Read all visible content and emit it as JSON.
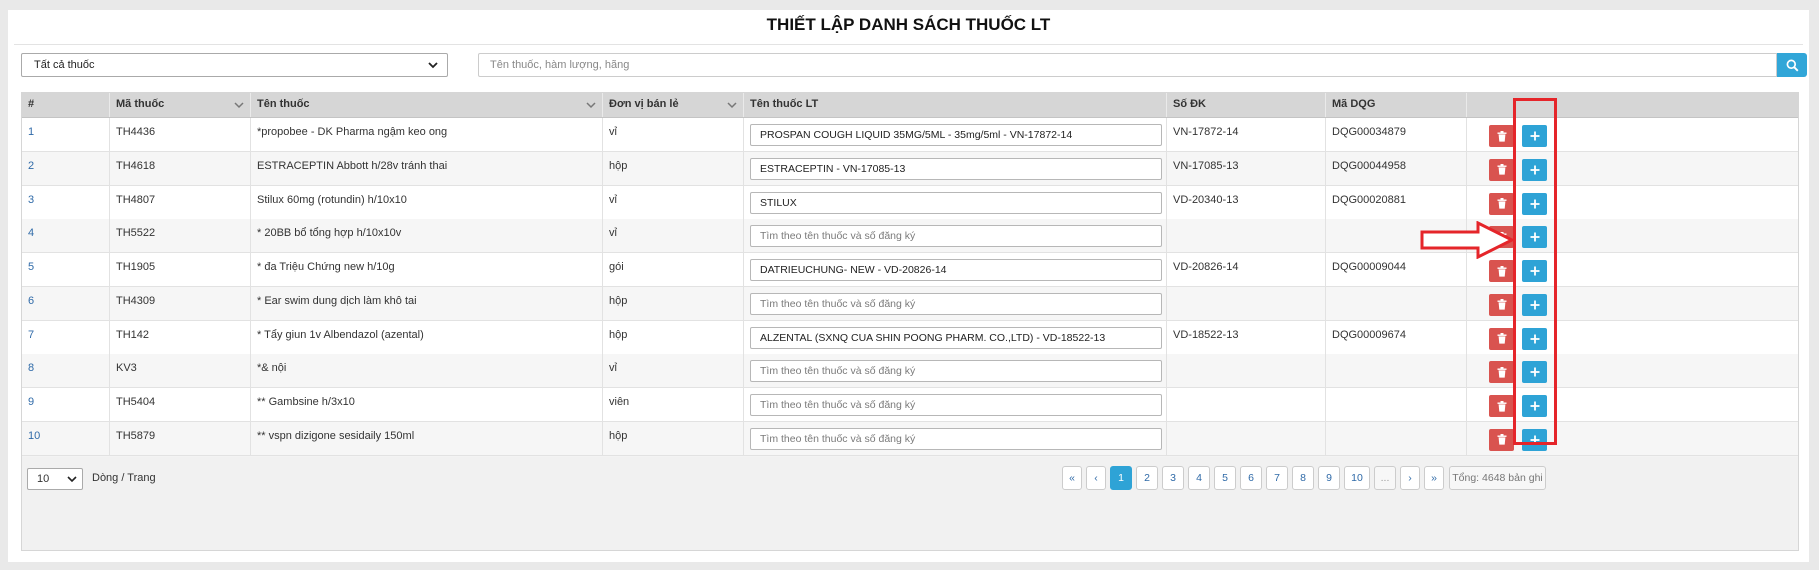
{
  "page": {
    "title": "THIẾT LẬP DANH SÁCH THUỐC LT"
  },
  "filter": {
    "selected": "Tất cả thuốc"
  },
  "search": {
    "placeholder": "Tên thuốc, hàm lượng, hãng",
    "icon": "search-icon"
  },
  "table": {
    "headers": {
      "index": "#",
      "code": "Mã thuốc",
      "name": "Tên thuốc",
      "unit": "Đơn vị bán lẻ",
      "lt_name": "Tên thuốc LT",
      "reg_no": "Số ĐK",
      "dqg": "Mã DQG"
    },
    "lt_placeholder": "Tìm theo tên thuốc và số đăng ký",
    "rows": [
      {
        "index": "1",
        "code": "TH4436",
        "name": "*propobee - DK Pharma ngậm keo ong",
        "unit": "vỉ",
        "lt_name": "PROSPAN COUGH LIQUID 35MG/5ML - 35mg/5ml - VN-17872-14",
        "reg_no": "VN-17872-14",
        "dqg": "DQG00034879"
      },
      {
        "index": "2",
        "code": "TH4618",
        "name": "ESTRACEPTIN Abbott h/28v tránh thai",
        "unit": "hộp",
        "lt_name": "ESTRACEPTIN - VN-17085-13",
        "reg_no": "VN-17085-13",
        "dqg": "DQG00044958"
      },
      {
        "index": "3",
        "code": "TH4807",
        "name": "Stilux 60mg (rotundin) h/10x10",
        "unit": "vỉ",
        "lt_name": "STILUX",
        "reg_no": "VD-20340-13",
        "dqg": "DQG00020881"
      },
      {
        "index": "4",
        "code": "TH5522",
        "name": "* 20BB bổ tổng hợp h/10x10v",
        "unit": "vỉ",
        "lt_name": "",
        "reg_no": "",
        "dqg": ""
      },
      {
        "index": "5",
        "code": "TH1905",
        "name": "* đa Triệu Chứng new h/10g",
        "unit": "gói",
        "lt_name": "DATRIEUCHUNG- NEW - VD-20826-14",
        "reg_no": "VD-20826-14",
        "dqg": "DQG00009044"
      },
      {
        "index": "6",
        "code": "TH4309",
        "name": "* Ear swim dung dịch làm khô tai",
        "unit": "hộp",
        "lt_name": "",
        "reg_no": "",
        "dqg": ""
      },
      {
        "index": "7",
        "code": "TH142",
        "name": "* Tẩy giun 1v Albendazol (azental)",
        "unit": "hộp",
        "lt_name": "ALZENTAL (SXNQ CUA SHIN POONG PHARM. CO.,LTD) - VD-18522-13",
        "reg_no": "VD-18522-13",
        "dqg": "DQG00009674"
      },
      {
        "index": "8",
        "code": "KV3",
        "name": "*& nội",
        "unit": "vỉ",
        "lt_name": "",
        "reg_no": "",
        "dqg": ""
      },
      {
        "index": "9",
        "code": "TH5404",
        "name": "** Gambsine h/3x10",
        "unit": "viên",
        "lt_name": "",
        "reg_no": "",
        "dqg": ""
      },
      {
        "index": "10",
        "code": "TH5879",
        "name": "** vspn dizigone sesidaily 150ml",
        "unit": "hộp",
        "lt_name": "",
        "reg_no": "",
        "dqg": ""
      }
    ]
  },
  "footer": {
    "page_size": "10",
    "page_size_label": "Dòng / Trang",
    "pagination": [
      "«",
      "‹",
      "1",
      "2",
      "3",
      "4",
      "5",
      "6",
      "7",
      "8",
      "9",
      "10",
      "...",
      "›",
      "»"
    ],
    "current_page": "1",
    "total": "Tổng: 4648 bản ghi"
  },
  "colors": {
    "accent": "#2ea3d6",
    "danger": "#d9534f",
    "annotation": "#e5252a"
  }
}
